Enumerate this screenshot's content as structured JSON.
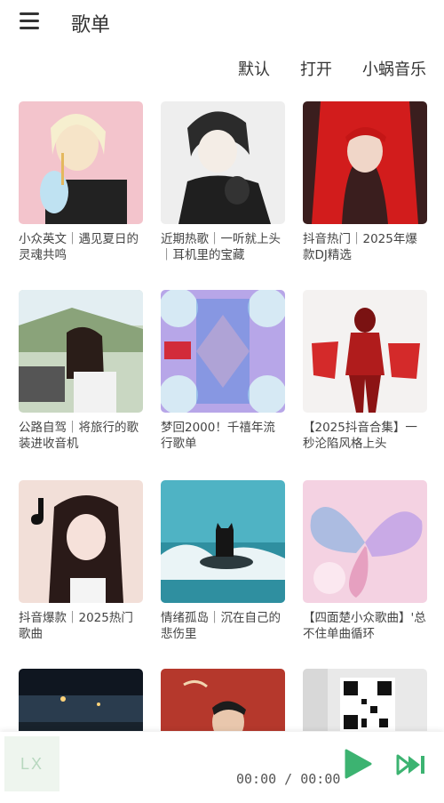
{
  "header": {
    "title": "歌单"
  },
  "sources": [
    {
      "label": "默认"
    },
    {
      "label": "打开"
    },
    {
      "label": "小蜗音乐"
    }
  ],
  "playlists": [
    {
      "title": "小众英文｜遇见夏日的灵魂共鸣"
    },
    {
      "title": "近期热歌｜一听就上头｜耳机里的宝藏"
    },
    {
      "title": "抖音热门｜2025年爆款DJ精选"
    },
    {
      "title": "公路自驾｜将旅行的歌装进收音机"
    },
    {
      "title": "梦回2000！千禧年流行歌单"
    },
    {
      "title": "【2025抖音合集】一秒沦陷风格上头"
    },
    {
      "title": "抖音爆款｜2025热门歌曲"
    },
    {
      "title": "情绪孤岛｜沉在自己的悲伤里"
    },
    {
      "title": "【四面楚小众歌曲】'总不住单曲循环"
    },
    {
      "title": ""
    },
    {
      "title": ""
    },
    {
      "title": ""
    }
  ],
  "player": {
    "cover_text": "LX",
    "time": "00:00 / 00:00",
    "accent": "#3cb371"
  }
}
